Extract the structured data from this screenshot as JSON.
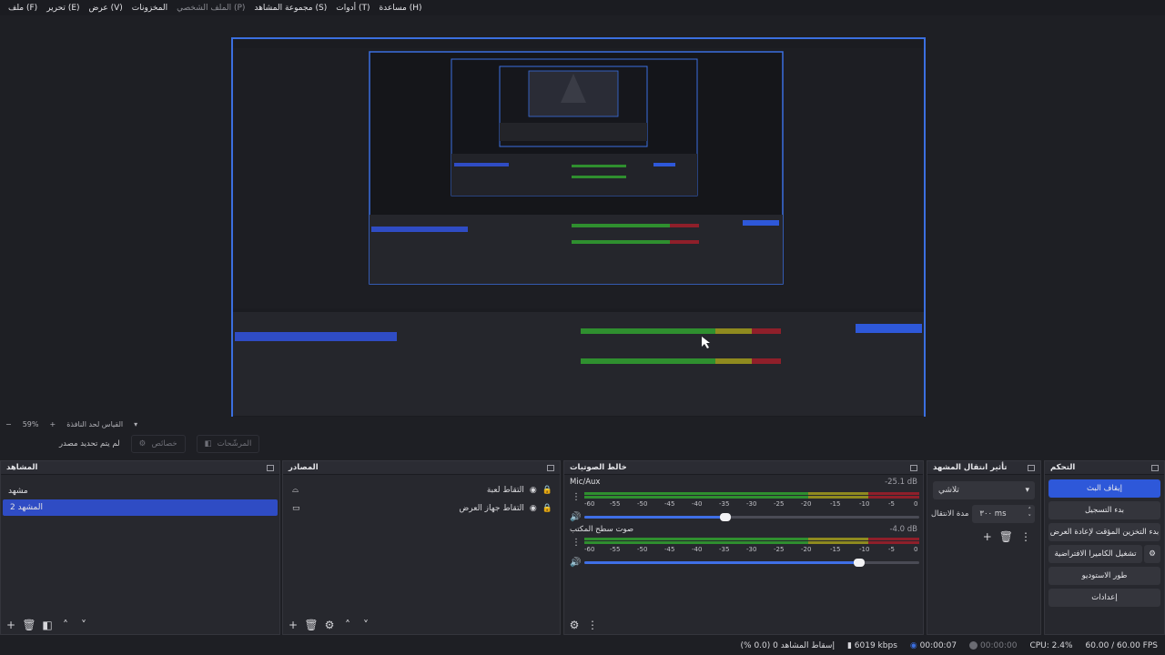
{
  "menu": [
    {
      "label": "ملف (F)"
    },
    {
      "label": "تحرير (E)"
    },
    {
      "label": "عرض (V)"
    },
    {
      "label": "المخزونات"
    },
    {
      "label": "الملف الشخصي (P)",
      "dim": true
    },
    {
      "label": "مجموعة المشاهد (S)"
    },
    {
      "label": "أدوات (T)"
    },
    {
      "label": "مساعدة (H)"
    }
  ],
  "zoom": {
    "minus": "−",
    "value": "59%",
    "plus": "+",
    "fit_label": "القياس لحد النافذة"
  },
  "context": {
    "message": "لم يتم تحديد مصدر",
    "properties_label": "خصائص",
    "filters_label": "المرشّحات"
  },
  "docks": {
    "scenes": {
      "title": "المشاهد",
      "items": [
        "مشهد",
        "المشهد 2"
      ],
      "selected": 1
    },
    "sources": {
      "title": "المصادر",
      "items": [
        {
          "label": "التقاط لعبة",
          "icon": "gamepad-icon"
        },
        {
          "label": "التقاط جهاز العرض",
          "icon": "monitor-icon"
        }
      ]
    },
    "mixer": {
      "title": "خالط الصوتيات",
      "channels": [
        {
          "name": "Mic/Aux",
          "db": "-25.1 dB",
          "volume": 0.42
        },
        {
          "name": "صوت سطح المكتب",
          "db": "-4.0 dB",
          "volume": 0.82
        }
      ],
      "scale": [
        "-60",
        "-55",
        "-50",
        "-45",
        "-40",
        "-35",
        "-30",
        "-25",
        "-20",
        "-15",
        "-10",
        "-5",
        "0"
      ]
    },
    "transitions": {
      "title": "تأثير انتقال المشهد",
      "selected": "تلاشي",
      "duration_label": "مدة الانتقال",
      "duration_value": "٣٠٠ ms"
    },
    "controls": {
      "title": "التحكم",
      "buttons": [
        "إيقاف البث",
        "بدء التسجيل",
        "بدء التخزين المؤقت لإعادة العرض",
        "تشغيل الكاميرا الافتراضية",
        "طور الاستوديو",
        "إعدادات"
      ]
    }
  },
  "status": {
    "dropped": "إسقاط المشاهد 0 (0.0 %)",
    "bitrate": "6019 kbps",
    "stream_time": "00:00:07",
    "rec_time": "00:00:00",
    "cpu": "CPU: 2.4%",
    "fps": "60.00 / 60.00 FPS"
  },
  "colors": {
    "accent": "#2e58d9",
    "meter_green": "#2f8f2f",
    "meter_yellow": "#8f8a1f",
    "meter_red": "#8f1f2a"
  }
}
